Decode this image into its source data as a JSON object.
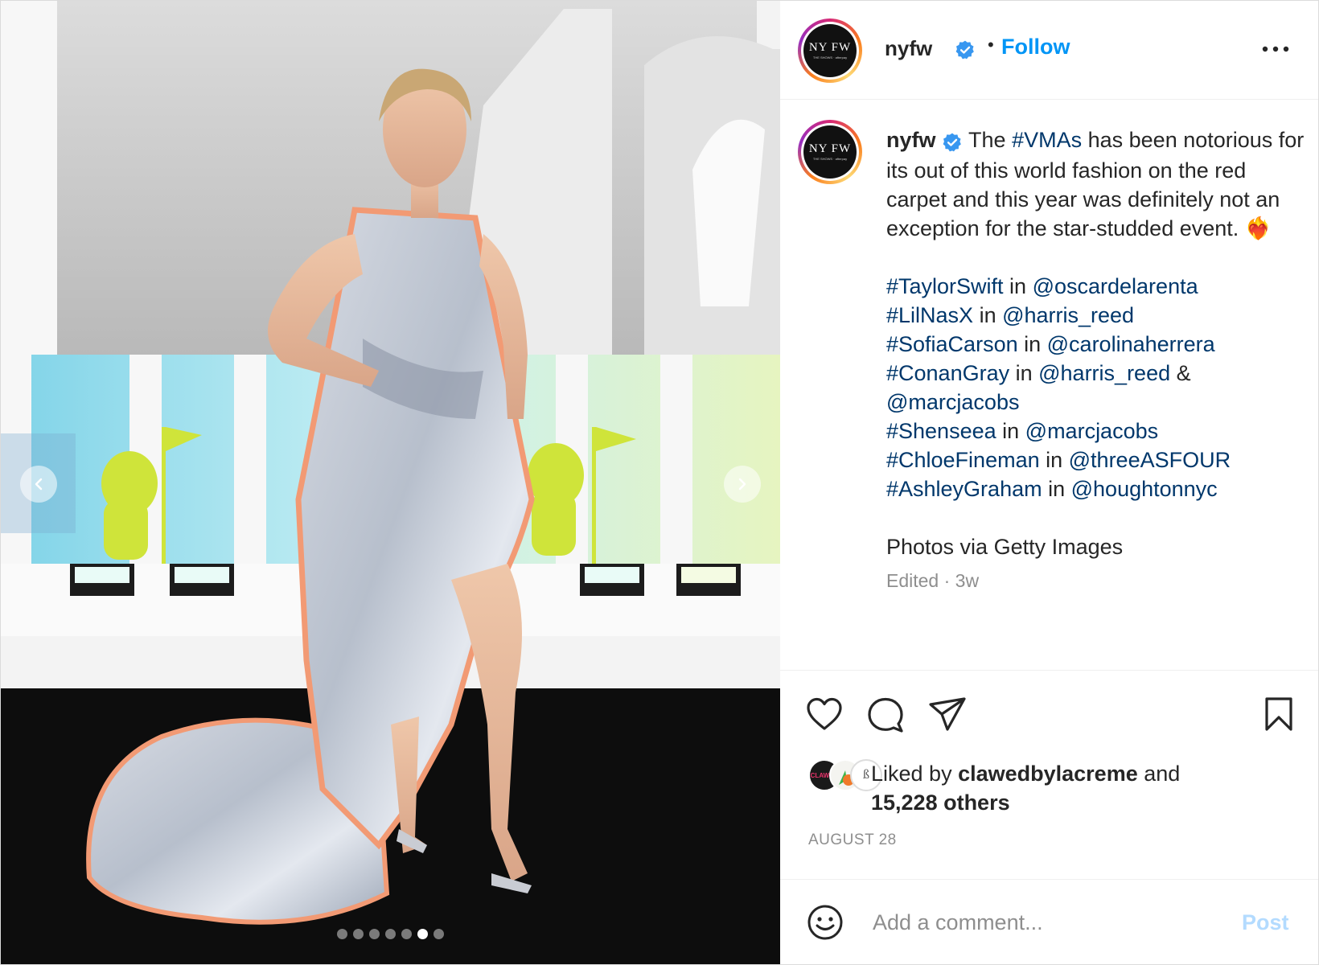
{
  "post": {
    "username": "nyfw",
    "follow_label": "Follow",
    "separator": "•",
    "avatar_logo": "NY FW",
    "avatar_sub": "THE SHOWS · afterpay",
    "caption": {
      "username": "nyfw",
      "intro_parts": [
        "The ",
        "#VMAs",
        " has been notorious for its out of this world fashion on the red carpet and this year was definitely not an exception for the star-studded event. "
      ],
      "heart_emoji": "❤️‍🔥",
      "credits": [
        {
          "tag": "#TaylorSwift",
          "sep": " in ",
          "handle": "@oscardelarenta",
          "extra": ""
        },
        {
          "tag": "#LilNasX",
          "sep": " in ",
          "handle": "@harris_reed",
          "extra": ""
        },
        {
          "tag": "#SofiaCarson",
          "sep": " in ",
          "handle": "@carolinaherrera",
          "extra": ""
        },
        {
          "tag": "#ConanGray",
          "sep": " in ",
          "handle": "@harris_reed",
          "extra": " & "
        },
        {
          "tag": "",
          "sep": "",
          "handle": "@marcjacobs",
          "extra": ""
        },
        {
          "tag": "#Shenseea",
          "sep": " in ",
          "handle": "@marcjacobs",
          "extra": ""
        },
        {
          "tag": "#ChloeFineman",
          "sep": " in ",
          "handle": "@threeASFOUR",
          "extra": ""
        },
        {
          "tag": "#AshleyGraham",
          "sep": " in ",
          "handle": "@houghtonnyc",
          "extra": ""
        }
      ],
      "photo_credit": "Photos via Getty Images",
      "edited": "Edited",
      "meta_sep": " · ",
      "age": "3w"
    },
    "likes": {
      "prefix": "Liked by ",
      "user": "clawedbylacreme",
      "middle": " and",
      "others": "15,228 others",
      "avatar1_text": "CLAWED"
    },
    "date": "AUGUST 28",
    "comment": {
      "placeholder": "Add a comment...",
      "post_label": "Post"
    },
    "carousel": {
      "total": 7,
      "active_index": 5
    }
  },
  "icons": {
    "verified": "verified-badge-icon",
    "more": "more-options-icon",
    "like": "heart-icon",
    "comment": "comment-bubble-icon",
    "share": "paper-plane-icon",
    "save": "bookmark-icon",
    "emoji": "smiley-icon",
    "prev": "chevron-left-icon",
    "next": "chevron-right-icon"
  },
  "colors": {
    "accent": "#0095f6",
    "link": "#00376b",
    "post_disabled": "#b3dbff",
    "verified": "#3897f0"
  }
}
